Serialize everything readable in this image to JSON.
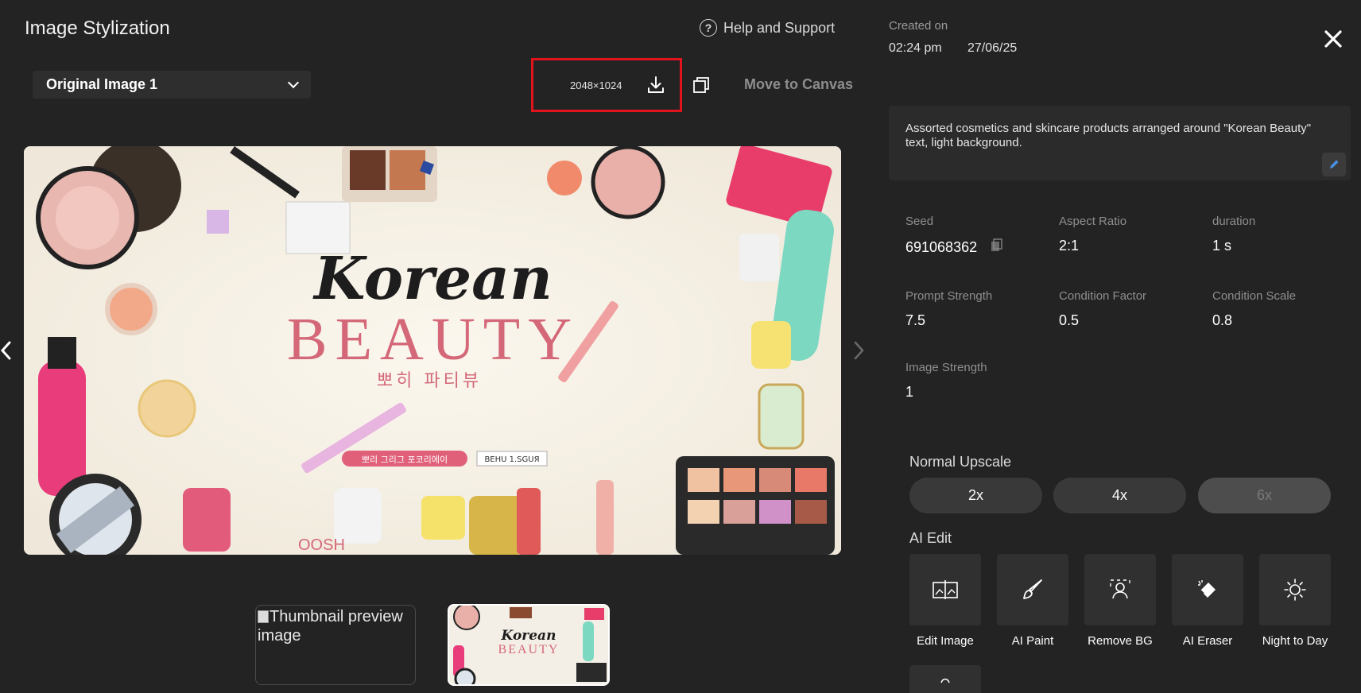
{
  "header": {
    "title": "Image Stylization",
    "help_label": "Help and Support"
  },
  "toolbar": {
    "variant_selected": "Original Image 1",
    "resolution": "2048×1024",
    "move_to_canvas": "Move to Canvas"
  },
  "preview": {
    "main_image": {
      "headline_script": "Korean",
      "headline": "BEAUTY",
      "subline": "뽀히 파티뷰",
      "tag_left": "뽀리 그리그 포코리에이",
      "tag_right": "BEНU 1.SGUЯ",
      "brand": "OOSH"
    },
    "thumbnails": [
      {
        "alt": "Thumbnail preview image"
      },
      {
        "headline_script": "Korean",
        "headline": "BEAUTY"
      }
    ]
  },
  "meta": {
    "created_label": "Created on",
    "created_time": "02:24 pm",
    "created_date": "27/06/25"
  },
  "prompt": {
    "text": "Assorted cosmetics and skincare products arranged around \"Korean Beauty\" text, light background."
  },
  "params": {
    "seed_label": "Seed",
    "seed_value": "691068362",
    "aspect_label": "Aspect Ratio",
    "aspect_value": "2:1",
    "duration_label": "duration",
    "duration_value": "1 s",
    "prompt_strength_label": "Prompt Strength",
    "prompt_strength_value": "7.5",
    "condition_factor_label": "Condition Factor",
    "condition_factor_value": "0.5",
    "condition_scale_label": "Condition Scale",
    "condition_scale_value": "0.8",
    "image_strength_label": "Image Strength",
    "image_strength_value": "1"
  },
  "upscale": {
    "title": "Normal Upscale",
    "options": [
      "2x",
      "4x",
      "6x"
    ]
  },
  "ai_edit": {
    "title": "AI Edit",
    "tools": [
      {
        "label": "Edit Image",
        "icon": "edit-image-icon"
      },
      {
        "label": "AI Paint",
        "icon": "brush-icon"
      },
      {
        "label": "Remove BG",
        "icon": "remove-bg-icon"
      },
      {
        "label": "AI Eraser",
        "icon": "eraser-icon"
      },
      {
        "label": "Night to Day",
        "icon": "sun-icon"
      }
    ]
  },
  "colors": {
    "background": "#232323",
    "highlight": "#e1141e",
    "beauty_text": "#d46878"
  }
}
